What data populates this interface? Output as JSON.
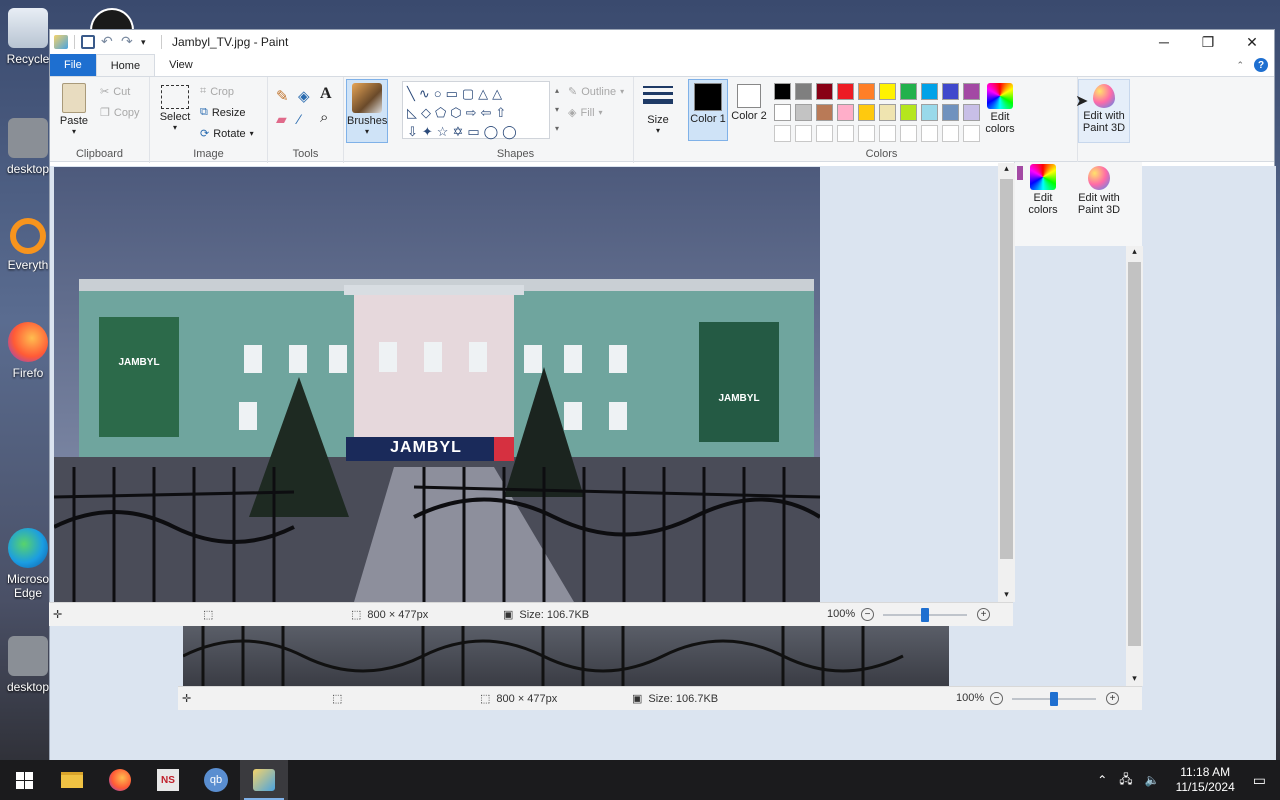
{
  "desktop": {
    "icons": [
      {
        "label": "Recycle"
      },
      {
        "label": "desktop"
      },
      {
        "label": "Everyth"
      },
      {
        "label": "Firefo"
      },
      {
        "label": "Microso Edge"
      },
      {
        "label": "desktop"
      }
    ]
  },
  "window": {
    "title": "Jambyl_TV.jpg - Paint",
    "controls": {
      "minimize": "─",
      "restore": "❐",
      "close": "✕"
    }
  },
  "tabs": {
    "file": "File",
    "home": "Home",
    "view": "View"
  },
  "ribbon": {
    "clipboard": {
      "paste": "Paste",
      "cut": "Cut",
      "copy": "Copy",
      "label": "Clipboard"
    },
    "image": {
      "select": "Select",
      "crop": "Crop",
      "resize": "Resize",
      "rotate": "Rotate",
      "label": "Image"
    },
    "tools": {
      "label": "Tools"
    },
    "brushes": {
      "label": "Brushes"
    },
    "shapes": {
      "outline": "Outline",
      "fill": "Fill",
      "label": "Shapes"
    },
    "size": {
      "label": "Size"
    },
    "colors": {
      "color1": "Color 1",
      "color2": "Color 2",
      "edit": "Edit colors",
      "label": "Colors",
      "palette_row1": [
        "#000000",
        "#7f7f7f",
        "#880015",
        "#ed1c24",
        "#ff7f27",
        "#fff200",
        "#22b14c",
        "#00a2e8",
        "#3f48cc",
        "#a349a4"
      ],
      "palette_row2": [
        "#ffffff",
        "#c3c3c3",
        "#b97a57",
        "#ffaec9",
        "#ffc90e",
        "#efe4b0",
        "#b5e61d",
        "#99d9ea",
        "#7092be",
        "#c8bfe7"
      ],
      "color1_value": "#000000",
      "color2_value": "#ffffff"
    },
    "paint3d": {
      "label": "Edit with Paint 3D"
    }
  },
  "back_panel": {
    "edit_colors": "Edit colors",
    "paint3d": "Edit with Paint 3D"
  },
  "photo": {
    "sign_text": "JAMBYL",
    "banner_left": "JAMBYL",
    "banner_right": "JAMBYL"
  },
  "status_front": {
    "dimensions": "800 × 477px",
    "size": "Size: 106.7KB",
    "zoom": "100%",
    "zoom_level": 0.5
  },
  "status_back": {
    "dimensions": "800 × 477px",
    "size": "Size: 106.7KB",
    "zoom": "100%",
    "zoom_level": 0.5
  },
  "taskbar": {
    "time": "11:18 AM",
    "date": "11/15/2024"
  }
}
